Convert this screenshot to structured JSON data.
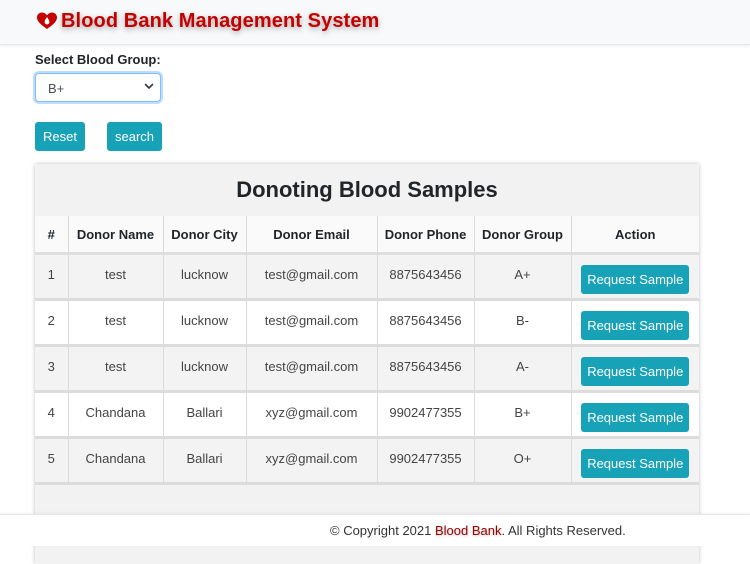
{
  "app": {
    "title": "Blood Bank Management System",
    "brand_color": "#c40000",
    "icon": "blood-drop-heart-icon"
  },
  "filter": {
    "label": "Select Blood Group:",
    "selected": "B+"
  },
  "buttons": {
    "reset": "Reset",
    "search": "search"
  },
  "table": {
    "title": "Donoting Blood Samples",
    "columns": [
      "#",
      "Donor Name",
      "Donor City",
      "Donor Email",
      "Donor Phone",
      "Donor Group",
      "Action"
    ],
    "rows": [
      {
        "num": "1",
        "name": "test",
        "city": "lucknow",
        "email": "test@gmail.com",
        "phone": "8875643456",
        "group": "A+",
        "action": "Request Sample"
      },
      {
        "num": "2",
        "name": "test",
        "city": "lucknow",
        "email": "test@gmail.com",
        "phone": "8875643456",
        "group": "B-",
        "action": "Request Sample"
      },
      {
        "num": "3",
        "name": "test",
        "city": "lucknow",
        "email": "test@gmail.com",
        "phone": "8875643456",
        "group": "A-",
        "action": "Request Sample"
      },
      {
        "num": "4",
        "name": "Chandana",
        "city": "Ballari",
        "email": "xyz@gmail.com",
        "phone": "9902477355",
        "group": "B+",
        "action": "Request Sample"
      },
      {
        "num": "5",
        "name": "Chandana",
        "city": "Ballari",
        "email": "xyz@gmail.com",
        "phone": "9902477355",
        "group": "O+",
        "action": "Request Sample"
      }
    ]
  },
  "footer": {
    "prefix": "© Copyright 2021 ",
    "brand": "Blood Bank",
    "suffix": ". All Rights Reserved."
  },
  "colors": {
    "accent": "#17a2b8",
    "footer_brand": "#a00000"
  }
}
